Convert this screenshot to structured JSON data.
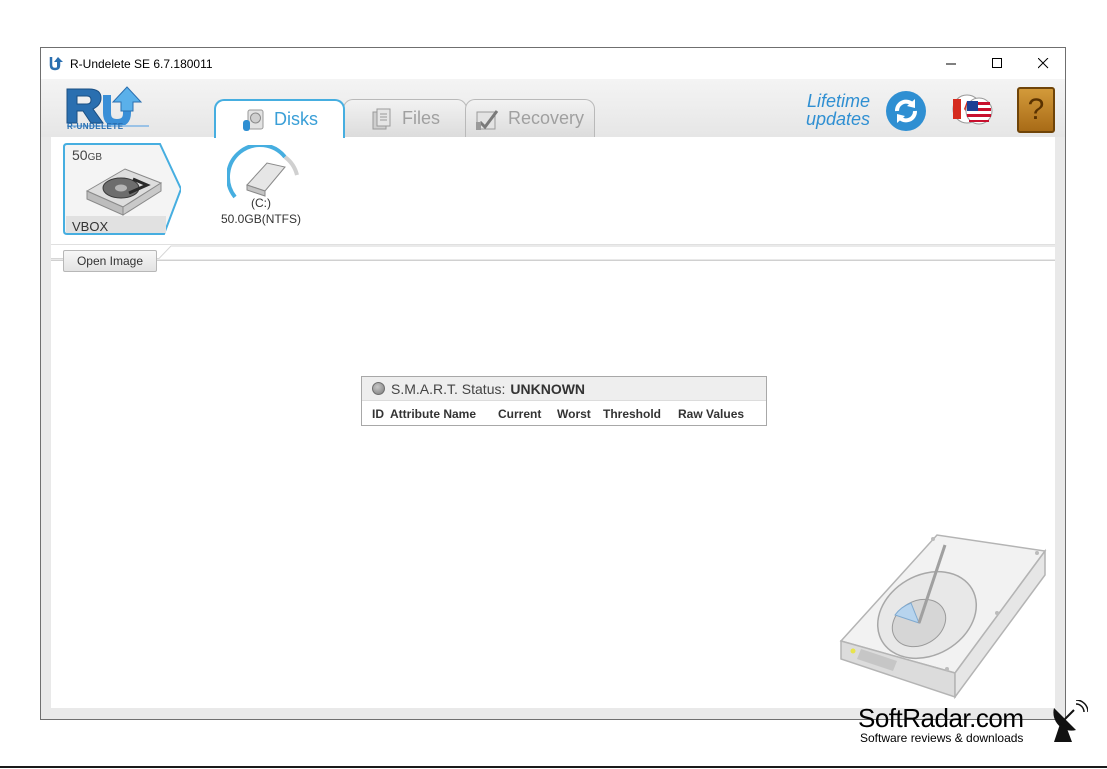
{
  "window": {
    "title": "R-Undelete SE 6.7.180011",
    "controls": [
      "minimize",
      "maximize",
      "close"
    ]
  },
  "header": {
    "logo_text": "R-UNDELETE",
    "tabs": [
      {
        "label": "Disks",
        "icon": "disk-icon",
        "active": true
      },
      {
        "label": "Files",
        "icon": "files-icon",
        "active": false
      },
      {
        "label": "Recovery",
        "icon": "recovery-icon",
        "active": false
      }
    ],
    "lifetime_line1": "Lifetime",
    "lifetime_line2": "updates",
    "help_label": "?"
  },
  "disks": {
    "drive": {
      "size_number": "50",
      "size_unit": "GB",
      "label": "VBOX"
    },
    "partition": {
      "name": "(C:)",
      "size": "50.0GB(NTFS)"
    }
  },
  "toolbar": {
    "open_image_label": "Open Image"
  },
  "smart": {
    "status_label": "S.M.A.R.T. Status:",
    "status_value": "UNKNOWN",
    "columns": [
      "ID",
      "Attribute Name",
      "Current",
      "Worst",
      "Threshold",
      "Raw Values"
    ]
  },
  "watermark": {
    "name": "SoftRadar.com",
    "tagline": "Software reviews & downloads"
  },
  "colors": {
    "accent": "#3a9fd7",
    "tab_active_border": "#46aee0",
    "help_button": "#c0852a"
  }
}
